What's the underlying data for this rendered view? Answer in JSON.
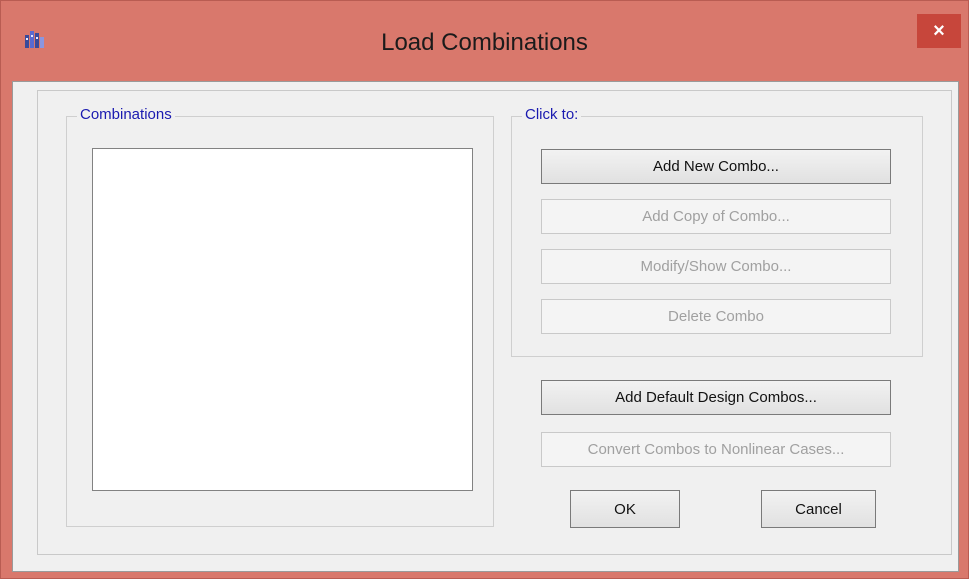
{
  "window": {
    "title": "Load Combinations",
    "close_symbol": "×",
    "app_icon": "etabs-app-icon",
    "close_icon": "close-icon"
  },
  "combinations_group": {
    "legend": "Combinations",
    "items": []
  },
  "actions_group": {
    "legend": "Click to:",
    "add_new": "Add New Combo...",
    "add_copy": "Add Copy of Combo...",
    "modify_show": "Modify/Show Combo...",
    "delete": "Delete Combo"
  },
  "add_default_design": "Add Default Design Combos...",
  "convert_nonlinear": "Convert Combos to Nonlinear Cases...",
  "ok_label": "OK",
  "cancel_label": "Cancel",
  "colors": {
    "titlebar": "#d9786c",
    "close_button": "#c7463b",
    "legend_text": "#1a1ab0",
    "dialog_bg": "#f0f0f0"
  }
}
